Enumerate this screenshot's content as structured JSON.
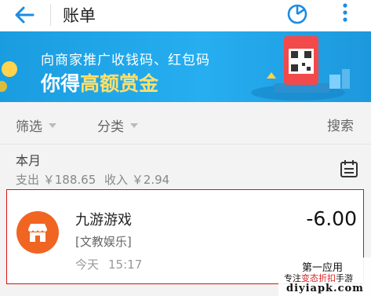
{
  "header": {
    "title": "账单",
    "back_icon": "back-arrow-icon",
    "chart_icon": "pie-chart-icon",
    "more_icon": "more-vertical-icon",
    "accent_color": "#1a8ce6"
  },
  "banner": {
    "line1": "向商家推广收钱码、红包码",
    "line2_prefix": "你得",
    "line2_highlight": "高额赏金",
    "bg_color": "#1a9de0",
    "highlight_color": "#ffe06a"
  },
  "filters": {
    "screen_label": "筛选",
    "category_label": "分类",
    "search_label": "搜索"
  },
  "month": {
    "title": "本月",
    "expense": "支出 ￥188.65",
    "income": "收入 ￥2.94",
    "calendar_icon": "calendar-icon"
  },
  "transactions": [
    {
      "name": "九游游戏",
      "category": "[文教娱乐]",
      "day": "今天",
      "time": "15:17",
      "amount": "-6.00",
      "icon": "store-icon",
      "icon_color": "#f06522"
    }
  ],
  "watermark": {
    "line1": "第一应用",
    "line2_prefix": "专注",
    "line2_highlight": "变态折扣",
    "line2_suffix": "手游",
    "line3": "diyiapk.com"
  }
}
